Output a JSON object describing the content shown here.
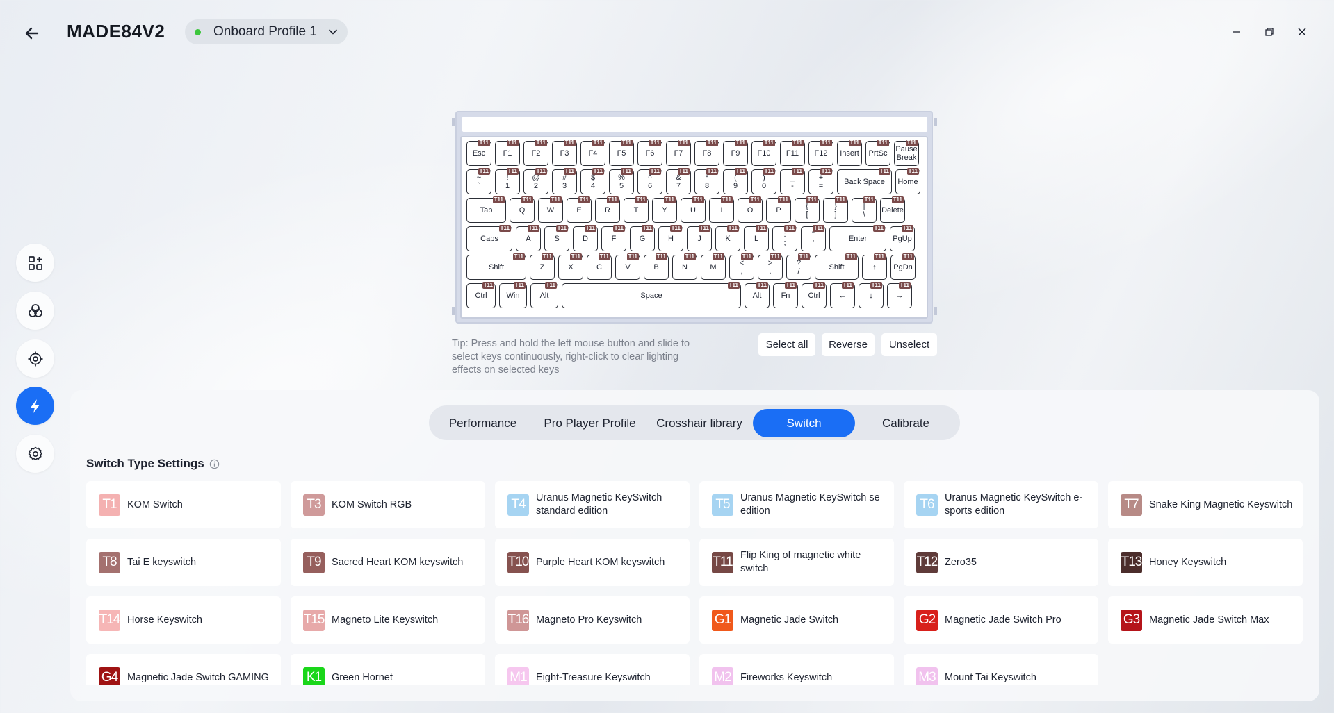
{
  "header": {
    "title": "MADE84V2",
    "profile": "Onboard Profile 1",
    "profile_status_color": "#3cc63c"
  },
  "sidebar": {
    "items": [
      {
        "icon": "dashboard-grid-icon",
        "active": false
      },
      {
        "icon": "lighting-rings-icon",
        "active": false
      },
      {
        "icon": "macro-target-icon",
        "active": false
      },
      {
        "icon": "lightning-bolt-icon",
        "active": true
      },
      {
        "icon": "gear-icon",
        "active": false
      }
    ]
  },
  "keyboard": {
    "tag": "T11",
    "rows": [
      [
        "Esc",
        "F1",
        "F2",
        "F3",
        "F4",
        "F5",
        "F6",
        "F7",
        "F8",
        "F9",
        "F10",
        "F11",
        "F12",
        "Insert",
        "PrtSc",
        "Pause\nBreak"
      ],
      [
        "~\n`",
        "!\n1",
        "@\n2",
        "#\n3",
        "$\n4",
        "%\n5",
        "^\n6",
        "&\n7",
        "*\n8",
        "(\n9",
        ")\n0",
        "_\n-",
        "+\n=",
        "Back Space",
        "Home"
      ],
      [
        "Tab",
        "Q",
        "W",
        "E",
        "R",
        "T",
        "Y",
        "U",
        "I",
        "O",
        "P",
        "{\n[",
        "}\n]",
        "|\n\\",
        "Delete"
      ],
      [
        "Caps",
        "A",
        "S",
        "D",
        "F",
        "G",
        "H",
        "J",
        "K",
        "L",
        ":\n;",
        "\"\n'",
        "Enter",
        "PgUp"
      ],
      [
        "Shift",
        "Z",
        "X",
        "C",
        "V",
        "B",
        "N",
        "M",
        "<\n,",
        ">\n.",
        "?\n/",
        "Shift",
        "↑",
        "PgDn"
      ],
      [
        "Ctrl",
        "Win",
        "Alt",
        "Space",
        "Alt",
        "Fn",
        "Ctrl",
        "←",
        "↓",
        "→"
      ]
    ]
  },
  "tip": "Tip: Press and hold the left mouse button and slide to select keys continuously, right-click to clear lighting effects on selected keys",
  "selection": {
    "select_all": "Select all",
    "reverse": "Reverse",
    "unselect": "Unselect"
  },
  "tabs": [
    {
      "label": "Performance",
      "active": false
    },
    {
      "label": "Pro Player Profile",
      "active": false
    },
    {
      "label": "Crosshair library",
      "active": false
    },
    {
      "label": "Switch",
      "active": true
    },
    {
      "label": "Calibrate",
      "active": false
    }
  ],
  "switch_section": {
    "title": "Switch Type Settings",
    "items": [
      {
        "code": "T1",
        "name": "KOM Switch",
        "color": "#f4b1b1"
      },
      {
        "code": "T3",
        "name": "KOM Switch RGB",
        "color": "#cf9a9a"
      },
      {
        "code": "T4",
        "name": "Uranus Magnetic KeySwitch standard edition",
        "color": "#a6d4f2"
      },
      {
        "code": "T5",
        "name": "Uranus Magnetic KeySwitch se edition",
        "color": "#a6d4f2"
      },
      {
        "code": "T6",
        "name": "Uranus Magnetic KeySwitch e-sports edition",
        "color": "#a6d4f2"
      },
      {
        "code": "T7",
        "name": "Snake King Magnetic Keyswitch",
        "color": "#b78a86"
      },
      {
        "code": "T8",
        "name": "Tai E keyswitch",
        "color": "#a4716f"
      },
      {
        "code": "T9",
        "name": "Sacred Heart KOM keyswitch",
        "color": "#965f5d"
      },
      {
        "code": "T10",
        "name": "Purple Heart KOM keyswitch",
        "color": "#86524f"
      },
      {
        "code": "T11",
        "name": "Flip King of magnetic white switch",
        "color": "#764845"
      },
      {
        "code": "T12",
        "name": "Zero35",
        "color": "#5f3b39"
      },
      {
        "code": "T13",
        "name": "Honey Keyswitch",
        "color": "#4b2d2b"
      },
      {
        "code": "T14",
        "name": "Horse Keyswitch",
        "color": "#f6b6b6"
      },
      {
        "code": "T15",
        "name": "Magneto Lite Keyswitch",
        "color": "#e7a9a9"
      },
      {
        "code": "T16",
        "name": "Magneto Pro Keyswitch",
        "color": "#cf9696"
      },
      {
        "code": "G1",
        "name": "Magnetic Jade Switch",
        "color": "#f0591b"
      },
      {
        "code": "G2",
        "name": "Magnetic Jade Switch Pro",
        "color": "#d8201b"
      },
      {
        "code": "G3",
        "name": "Magnetic Jade Switch Max",
        "color": "#b5141a"
      },
      {
        "code": "G4",
        "name": "Magnetic Jade Switch GAMING",
        "color": "#9f1313"
      },
      {
        "code": "K1",
        "name": "Green Hornet",
        "color": "#1ad61a"
      },
      {
        "code": "M1",
        "name": "Eight-Treasure Keyswitch",
        "color": "#f6c7ef"
      },
      {
        "code": "M2",
        "name": "Fireworks Keyswitch",
        "color": "#f1c2ee"
      },
      {
        "code": "M3",
        "name": "Mount Tai Keyswitch",
        "color": "#f1c2ee"
      }
    ]
  },
  "colors": {
    "accent": "#1a6ef5",
    "key_tag": "#7a4a4a"
  }
}
